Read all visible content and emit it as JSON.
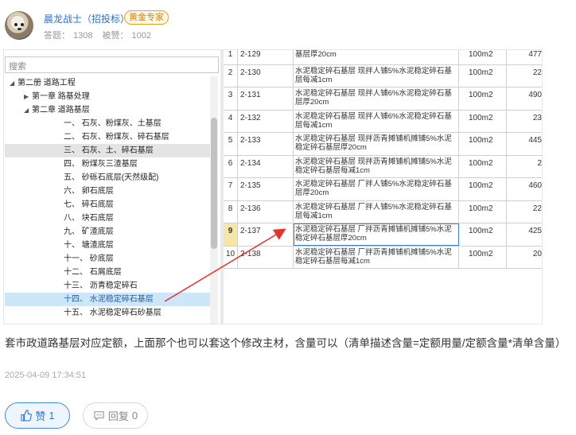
{
  "user": {
    "name": "晨龙战士（招投标）",
    "badge": "黄金专家",
    "answers_label": "答题：",
    "answers": "1308",
    "likes_label": "被赞：",
    "likes": "1002"
  },
  "screenshot": {
    "search_placeholder": "搜索",
    "tree": [
      {
        "indent": 0,
        "arrow": "◢",
        "label": "第二册 道路工程"
      },
      {
        "indent": 1,
        "arrow": "▶",
        "label": "第一章 路基处理"
      },
      {
        "indent": 1,
        "arrow": "◢",
        "label": "第二章 道路基层"
      },
      {
        "indent": 2,
        "arrow": "",
        "label": "一、 石灰、粉煤灰、土基层"
      },
      {
        "indent": 2,
        "arrow": "",
        "label": "二、 石灰、粉煤灰、碎石基层"
      },
      {
        "indent": 2,
        "arrow": "",
        "label": "三、 石灰、土、碎石基层",
        "state": "hl"
      },
      {
        "indent": 2,
        "arrow": "",
        "label": "四、 粉煤灰三渣基层"
      },
      {
        "indent": 2,
        "arrow": "",
        "label": "五、 砂砾石底层(天然级配)"
      },
      {
        "indent": 2,
        "arrow": "",
        "label": "六、 卵石底层"
      },
      {
        "indent": 2,
        "arrow": "",
        "label": "七、 碎石底层"
      },
      {
        "indent": 2,
        "arrow": "",
        "label": "八、 块石底层"
      },
      {
        "indent": 2,
        "arrow": "",
        "label": "九、 矿渣底层"
      },
      {
        "indent": 2,
        "arrow": "",
        "label": "十、 塘渣底层"
      },
      {
        "indent": 2,
        "arrow": "",
        "label": "十一、 砂底层"
      },
      {
        "indent": 2,
        "arrow": "",
        "label": "十二、 石屑底层"
      },
      {
        "indent": 2,
        "arrow": "",
        "label": "十三、 沥青稳定碎石"
      },
      {
        "indent": 2,
        "arrow": "",
        "label": "十四、 水泥稳定碎石基层",
        "state": "sel"
      },
      {
        "indent": 2,
        "arrow": "",
        "label": "十五、 水泥稳定碎石砂基层"
      }
    ],
    "rows": [
      {
        "idx": "1",
        "code": "2-129",
        "name": "基层厚20cm",
        "unit": "100m2",
        "qty": "477",
        "partial": true
      },
      {
        "idx": "2",
        "code": "2-130",
        "name": "水泥稳定碎石基层 现拌人铺5%水泥稳定碎石基层每减1cm",
        "unit": "100m2",
        "qty": "22"
      },
      {
        "idx": "3",
        "code": "2-131",
        "name": "水泥稳定碎石基层 现拌人铺6%水泥稳定碎石基层厚20cm",
        "unit": "100m2",
        "qty": "490"
      },
      {
        "idx": "4",
        "code": "2-132",
        "name": "水泥稳定碎石基层 现拌人铺6%水泥稳定碎石基层每减1cm",
        "unit": "100m2",
        "qty": "23"
      },
      {
        "idx": "5",
        "code": "2-133",
        "name": "水泥稳定碎石基层 现拌沥青摊铺机摊铺5%水泥稳定碎石基层厚20cm",
        "unit": "100m2",
        "qty": "445"
      },
      {
        "idx": "6",
        "code": "2-134",
        "name": "水泥稳定碎石基层 现拌沥青摊铺机摊铺5%水泥稳定碎石基层每减1cm",
        "unit": "100m2",
        "qty": "2"
      },
      {
        "idx": "7",
        "code": "2-135",
        "name": "水泥稳定碎石基层 厂拌人铺5%水泥稳定碎石基层厚20cm",
        "unit": "100m2",
        "qty": "460"
      },
      {
        "idx": "8",
        "code": "2-136",
        "name": "水泥稳定碎石基层 厂拌人铺5%水泥稳定碎石基层每减1cm",
        "unit": "100m2",
        "qty": "22"
      },
      {
        "idx": "9",
        "code": "2-137",
        "name": "水泥稳定碎石基层 厂拌沥青摊铺机摊铺5%水泥稳定碎石基层厚20cm",
        "unit": "100m2",
        "qty": "425",
        "active": true
      },
      {
        "idx": "10",
        "code": "2-138",
        "name": "水泥稳定碎石基层 厂拌沥青摊铺机摊铺5%水泥稳定碎石基层每减1cm",
        "unit": "100m2",
        "qty": "20"
      }
    ]
  },
  "comment": {
    "text": "套市政道路基层对应定额，上面那个也可以套这个修改主材，含量可以（清单描述含量=定额用量/定额含量*清单含量）",
    "time": "2025-04-09 17:34:51"
  },
  "actions": {
    "like_label": "赞",
    "like_count": "1",
    "reply_label": "回复",
    "reply_count": "0"
  },
  "colors": {
    "link_blue": "#2a6fd6",
    "badge_orange": "#d98500",
    "arrow_red": "#e8312a",
    "selection_blue": "#cde6f8"
  }
}
